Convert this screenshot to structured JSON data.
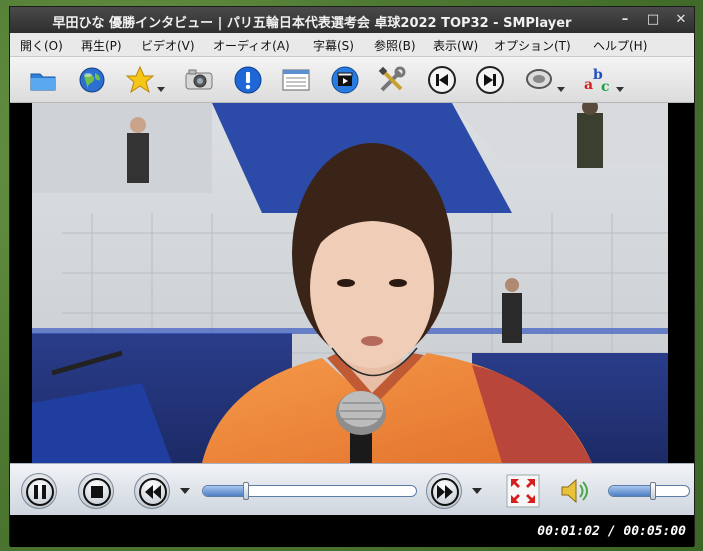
{
  "window": {
    "title": "早田ひな 優勝インタビュー | パリ五輪日本代表選考会 卓球2022 TOP32 - SMPlayer",
    "controls": {
      "minimize": "–",
      "maximize": "□",
      "close": "✕"
    }
  },
  "menu": {
    "items": [
      {
        "label": "開く(O)"
      },
      {
        "label": "再生(P)"
      },
      {
        "label": "ビデオ(V)"
      },
      {
        "label": "オーディオ(A)"
      },
      {
        "label": "字幕(S)"
      },
      {
        "label": "参照(B)"
      },
      {
        "label": "表示(W)"
      },
      {
        "label": "オプション(T)"
      },
      {
        "label": "ヘルプ(H)"
      }
    ]
  },
  "toolbar": {
    "icons": [
      "folder-icon",
      "globe-icon",
      "favorites-star-icon",
      "screenshot-camera-icon",
      "info-icon",
      "playlist-icon",
      "video-clapper-icon",
      "preferences-tools-icon",
      "previous-icon",
      "next-icon",
      "audio-track-icon",
      "subtitles-abc-icon"
    ]
  },
  "controls": {
    "seek_progress": 0.2,
    "volume_level": 0.55,
    "icons": [
      "pause-icon",
      "stop-icon",
      "rewind-icon",
      "forward-icon",
      "fullscreen-icon",
      "volume-icon"
    ]
  },
  "status": {
    "time": "00:01:02 / 00:05:00"
  },
  "colors": {
    "accent": "#4d7ec4",
    "jersey": "#f08a3c",
    "desktop": "#4f7a33"
  }
}
